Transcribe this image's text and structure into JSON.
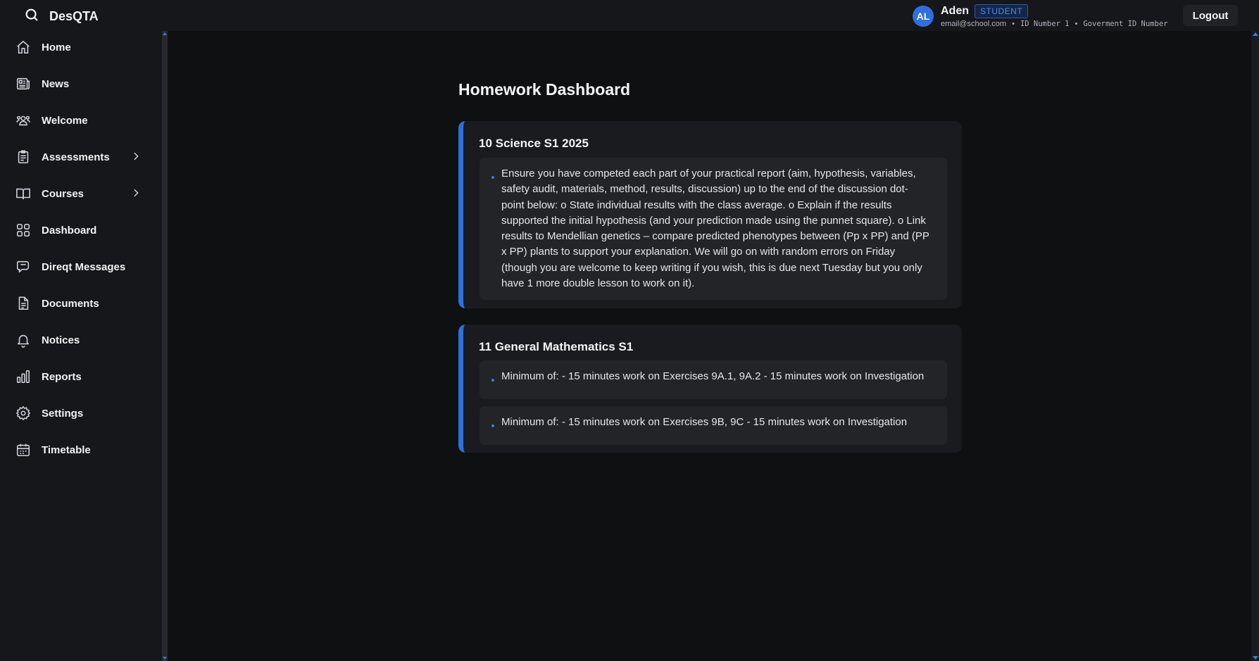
{
  "app": {
    "name": "DesQTA"
  },
  "user": {
    "initials": "AL",
    "name": "Aden",
    "role": "STUDENT",
    "email": "email@school.com",
    "id_number": "ID Number 1",
    "gov_id": "Goverment ID Number",
    "separator": "•"
  },
  "header": {
    "logout_label": "Logout"
  },
  "sidebar": {
    "items": [
      {
        "label": "Home",
        "icon": "home-icon"
      },
      {
        "label": "News",
        "icon": "newspaper-icon"
      },
      {
        "label": "Welcome",
        "icon": "users-icon"
      },
      {
        "label": "Assessments",
        "icon": "clipboard-icon",
        "has_submenu": true
      },
      {
        "label": "Courses",
        "icon": "book-open-icon",
        "has_submenu": true
      },
      {
        "label": "Dashboard",
        "icon": "grid-icon"
      },
      {
        "label": "Direqt Messages",
        "icon": "chat-icon"
      },
      {
        "label": "Documents",
        "icon": "document-icon"
      },
      {
        "label": "Notices",
        "icon": "bell-icon"
      },
      {
        "label": "Reports",
        "icon": "bar-chart-icon"
      },
      {
        "label": "Settings",
        "icon": "gear-icon"
      },
      {
        "label": "Timetable",
        "icon": "calendar-icon"
      }
    ]
  },
  "main": {
    "title": "Homework Dashboard",
    "subjects": [
      {
        "title": "10 Science S1 2025",
        "items": [
          "Ensure you have competed each part of your practical report (aim, hypothesis, variables, safety audit, materials, method, results, discussion) up to the end of the discussion dot-point below: o State individual results with the class average. o Explain if the results supported the initial hypothesis (and your prediction made using the punnet square). o Link results to Mendellian genetics – compare predicted phenotypes between (Pp x PP) and (PP x PP) plants to support your explanation. We will go on with random errors on Friday (though you are welcome to keep writing if you wish, this is due next Tuesday but you only have 1 more double lesson to work on it)."
        ]
      },
      {
        "title": "11 General Mathematics S1",
        "items": [
          "Minimum of: - 15 minutes work on Exercises 9A.1, 9A.2 - 15 minutes work on Investigation",
          "Minimum of: - 15 minutes work on Exercises 9B, 9C - 15 minutes work on Investigation"
        ]
      }
    ]
  },
  "colors": {
    "accent": "#2f6fe0",
    "background": "#0f1012",
    "sidebar": "#16171a",
    "card": "#1a1b1e"
  }
}
